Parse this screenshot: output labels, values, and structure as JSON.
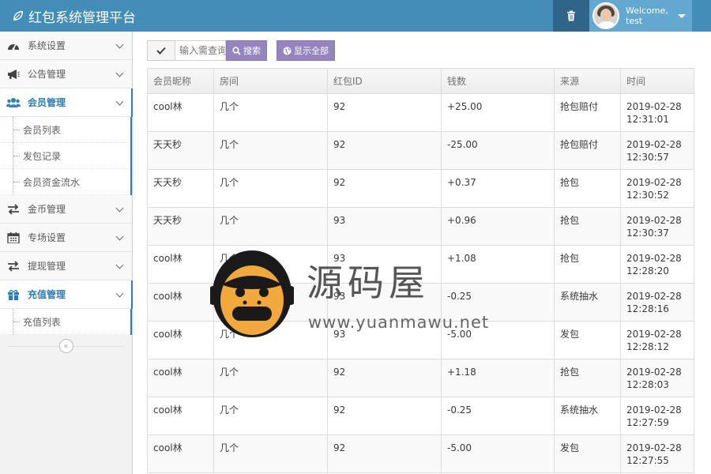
{
  "app": {
    "title": "红包系统管理平台",
    "welcome": "Welcome,",
    "username": "test"
  },
  "sidebar": {
    "items": [
      {
        "label": "系统设置",
        "icon": "dashboard-icon"
      },
      {
        "label": "公告管理",
        "icon": "megaphone-icon"
      },
      {
        "label": "会员管理",
        "icon": "users-icon",
        "active": true
      },
      {
        "label": "金币管理",
        "icon": "exchange-icon"
      },
      {
        "label": "专场设置",
        "icon": "calendar-icon"
      },
      {
        "label": "提现管理",
        "icon": "exchange-icon"
      },
      {
        "label": "充值管理",
        "icon": "gift-icon",
        "active": true
      }
    ],
    "member_subitems": [
      "会员列表",
      "发包记录",
      "会员资金流水"
    ],
    "recharge_subitems": [
      "充值列表"
    ],
    "collapse_symbol": "«"
  },
  "toolbar": {
    "search_placeholder": "输入需查询",
    "search_label": "搜索",
    "show_all_label": "显示全部"
  },
  "table": {
    "headers": [
      "会员昵称",
      "房间",
      "红包ID",
      "钱数",
      "来源",
      "时间"
    ],
    "rows": [
      [
        "cool林",
        "几个",
        "92",
        "+25.00",
        "抢包赔付",
        "2019-02-28 12:31:01"
      ],
      [
        "天天秒",
        "几个",
        "92",
        "-25.00",
        "抢包赔付",
        "2019-02-28 12:30:57"
      ],
      [
        "天天秒",
        "几个",
        "92",
        "+0.37",
        "抢包",
        "2019-02-28 12:30:52"
      ],
      [
        "天天秒",
        "几个",
        "93",
        "+0.96",
        "抢包",
        "2019-02-28 12:30:37"
      ],
      [
        "cool林",
        "几个",
        "93",
        "+1.08",
        "抢包",
        "2019-02-28 12:28:20"
      ],
      [
        "cool林",
        "几个",
        "93",
        "-0.25",
        "系统抽水",
        "2019-02-28 12:28:16"
      ],
      [
        "cool林",
        "几个",
        "93",
        "-5.00",
        "发包",
        "2019-02-28 12:28:12"
      ],
      [
        "cool林",
        "几个",
        "92",
        "+1.18",
        "抢包",
        "2019-02-28 12:28:03"
      ],
      [
        "cool林",
        "几个",
        "92",
        "-0.25",
        "系统抽水",
        "2019-02-28 12:27:59"
      ],
      [
        "cool林",
        "几个",
        "92",
        "-5.00",
        "发包",
        "2019-02-28 12:27:55"
      ]
    ]
  },
  "watermark": {
    "brand": "源码屋",
    "url": "www.yuanmawu.net"
  },
  "colors": {
    "navbar": "#438eb9",
    "accent": "#2b7dbc",
    "button_purple": "#9585bf"
  }
}
